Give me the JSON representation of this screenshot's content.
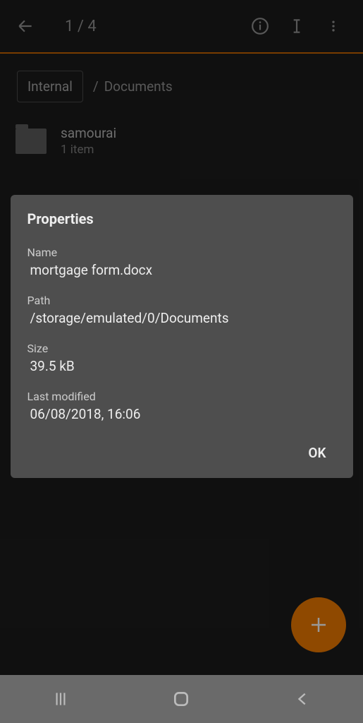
{
  "topbar": {
    "counter": "1 / 4"
  },
  "breadcrumb": {
    "root": "Internal",
    "current": "Documents",
    "sep": "/"
  },
  "files": [
    {
      "name": "samourai",
      "sub": "1 item"
    }
  ],
  "modal": {
    "title": "Properties",
    "name_label": "Name",
    "name_value": "mortgage form.docx",
    "path_label": "Path",
    "path_value": "/storage/emulated/0/Documents",
    "size_label": "Size",
    "size_value": "39.5 kB",
    "modified_label": "Last modified",
    "modified_value": "06/08/2018, 16:06",
    "ok": "OK"
  }
}
